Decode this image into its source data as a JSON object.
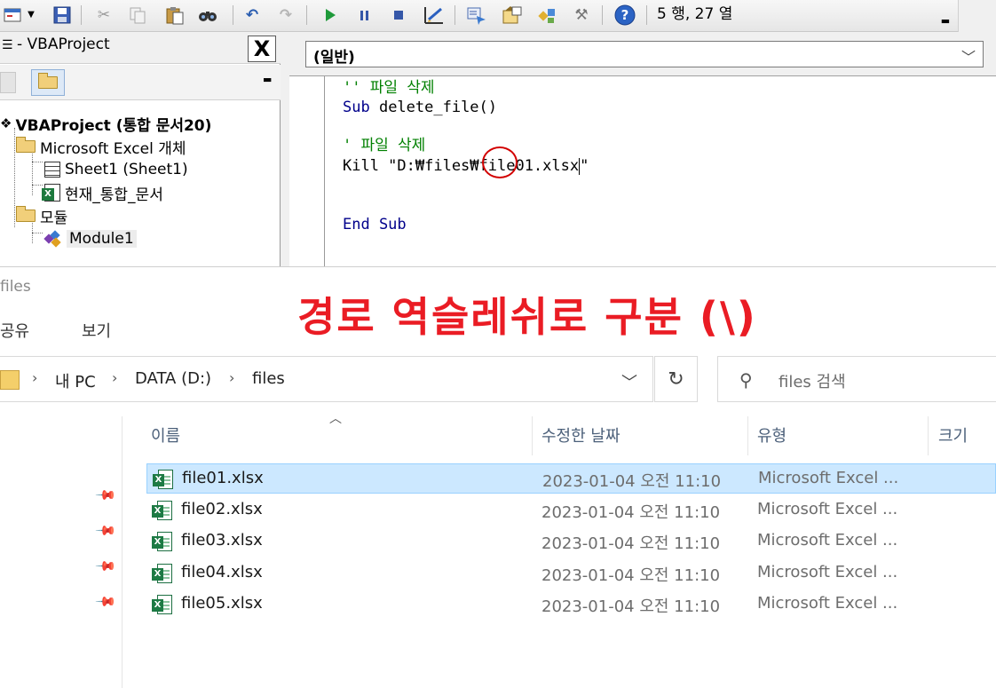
{
  "toolbar": {
    "position_readout": "5 행, 27 열",
    "buttons": [
      "vba-window-icon",
      "save-icon",
      "cut-icon",
      "copy-icon",
      "paste-icon",
      "find-icon",
      "undo-icon",
      "redo-icon",
      "run-icon",
      "break-icon",
      "reset-icon",
      "design-mode-icon",
      "project-explorer-icon",
      "properties-icon",
      "object-browser-icon",
      "toolbox-icon",
      "help-icon"
    ]
  },
  "project_explorer": {
    "title": "- VBAProject",
    "close_label": "X",
    "tree": {
      "root": "VBAProject (통합 문서20)",
      "excel_objects": "Microsoft Excel 개체",
      "sheet1": "Sheet1 (Sheet1)",
      "this_workbook": "현재_통합_문서",
      "modules": "모듈",
      "module1": "Module1"
    }
  },
  "code_window": {
    "object_combo": "(일반)",
    "lines": {
      "comment1": "'' 파일 삭제",
      "sub_kw": "Sub",
      "sub_name": " delete_file()",
      "comment2": "' 파일 삭제",
      "kill_stmt": "Kill \"D:₩files₩file01.xlsx",
      "kill_end": "\"",
      "end_kw": "End Sub"
    }
  },
  "explorer": {
    "window_title": "files",
    "annotation": "경로 역슬레쉬로 구분 (\\)",
    "ribbon_tabs": [
      "공유",
      "보기"
    ],
    "breadcrumb": [
      "내 PC",
      "DATA (D:)",
      "files"
    ],
    "search_placeholder": "files 검색",
    "columns": {
      "name": "이름",
      "date": "수정한 날짜",
      "type": "유형",
      "size": "크기"
    },
    "files": [
      {
        "name": "file01.xlsx",
        "date": "2023-01-04 오전 11:10",
        "type": "Microsoft Excel ...",
        "selected": true
      },
      {
        "name": "file02.xlsx",
        "date": "2023-01-04 오전 11:10",
        "type": "Microsoft Excel ...",
        "selected": false
      },
      {
        "name": "file03.xlsx",
        "date": "2023-01-04 오전 11:10",
        "type": "Microsoft Excel ...",
        "selected": false
      },
      {
        "name": "file04.xlsx",
        "date": "2023-01-04 오전 11:10",
        "type": "Microsoft Excel ...",
        "selected": false
      },
      {
        "name": "file05.xlsx",
        "date": "2023-01-04 오전 11:10",
        "type": "Microsoft Excel ...",
        "selected": false
      }
    ]
  },
  "colors": {
    "annotation_red": "#ea1c24",
    "keyword_blue": "#00008b",
    "comment_green": "#008000",
    "selection_bg": "#cce8ff"
  }
}
